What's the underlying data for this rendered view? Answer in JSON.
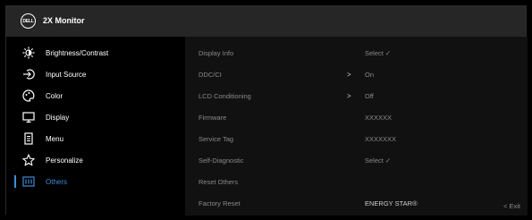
{
  "header": {
    "logo_text": "DELL",
    "model": "2X Monitor"
  },
  "sidebar": {
    "items": [
      {
        "label": "Brightness/Contrast",
        "icon": "brightness-icon",
        "active": false
      },
      {
        "label": "Input Source",
        "icon": "input-source-icon",
        "active": false
      },
      {
        "label": "Color",
        "icon": "color-palette-icon",
        "active": false
      },
      {
        "label": "Display",
        "icon": "display-icon",
        "active": false
      },
      {
        "label": "Menu",
        "icon": "menu-icon",
        "active": false
      },
      {
        "label": "Personalize",
        "icon": "star-icon",
        "active": false
      },
      {
        "label": "Others",
        "icon": "others-icon",
        "active": true
      }
    ]
  },
  "main": {
    "rows": [
      {
        "label": "Display Info",
        "arrow": "",
        "value": "Select  ✓"
      },
      {
        "label": "DDC/CI",
        "arrow": ">",
        "value": "On"
      },
      {
        "label": "LCD Conditioning",
        "arrow": ">",
        "value": "Off"
      },
      {
        "label": "Firmware",
        "arrow": "",
        "value": "XXXXXX"
      },
      {
        "label": "Service Tag",
        "arrow": "",
        "value": "XXXXXXX"
      },
      {
        "label": "Self-Diagnostic",
        "arrow": "",
        "value": "Select  ✓"
      },
      {
        "label": "Reset Others",
        "arrow": "",
        "value": ""
      },
      {
        "label": "Factory Reset",
        "arrow": "",
        "value": "ENERGY STAR®"
      }
    ]
  },
  "footer": {
    "exit_label": "<  Exit"
  },
  "colors": {
    "accent": "#3d8bd9",
    "title_bar": "#262626",
    "panel": "#111111",
    "dim_text": "#8a8a8a"
  }
}
